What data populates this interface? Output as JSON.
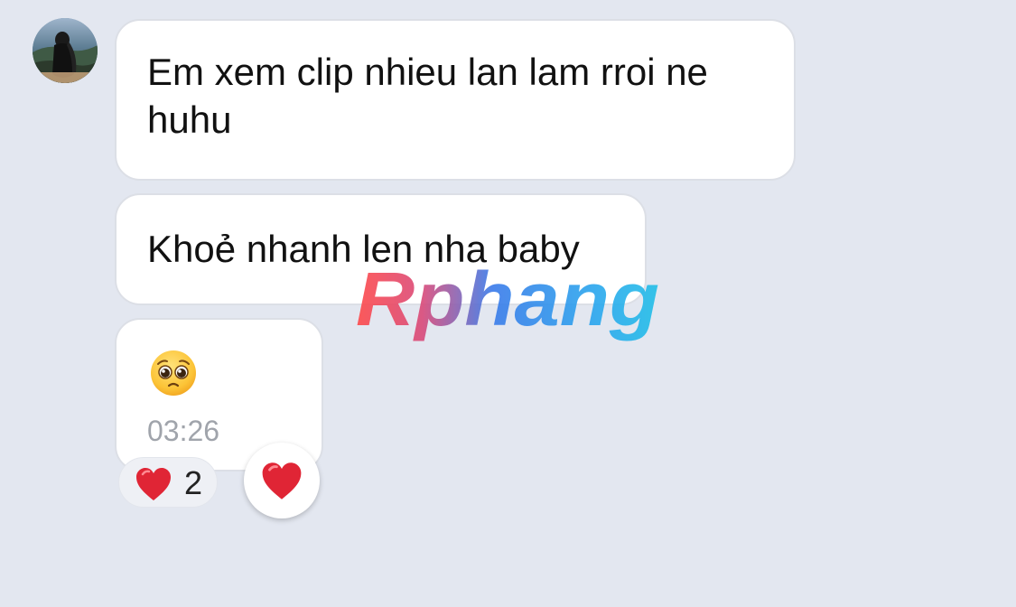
{
  "sender": {
    "avatar_icon": "avatar-photo-icon"
  },
  "messages": [
    {
      "text": "Em xem clip nhieu lan lam rroi ne huhu"
    },
    {
      "text": "Khoẻ nhanh len nha baby"
    },
    {
      "emoji_name": "pleading-face-icon",
      "time": "03:26"
    }
  ],
  "reactions": {
    "icon": "heart-icon",
    "count": "2",
    "quick_react_icon": "heart-icon"
  },
  "watermark": {
    "text": "Rphang"
  },
  "colors": {
    "background": "#e3e7f0",
    "bubble": "#ffffff",
    "heart": "#e02535",
    "time": "#a0a4ab"
  }
}
